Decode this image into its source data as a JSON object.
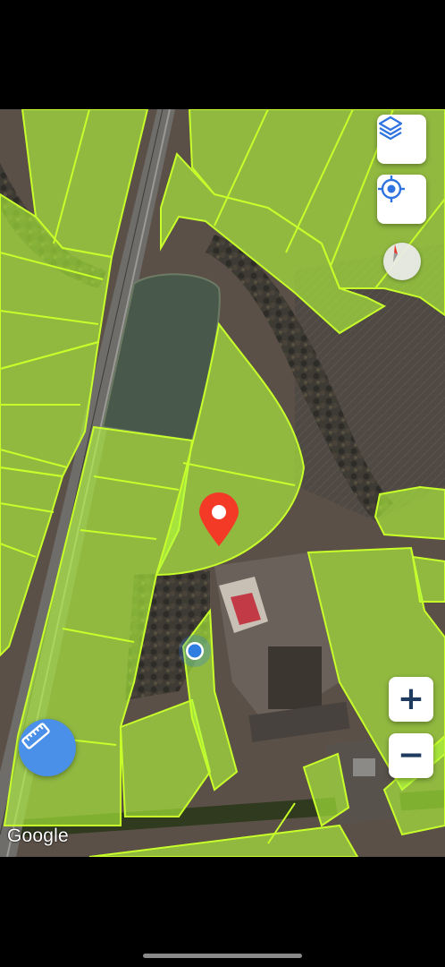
{
  "map": {
    "attribution": "Google",
    "controls": {
      "layers_icon": "layers-icon",
      "locate_icon": "crosshair-icon",
      "compass_icon": "compass-icon",
      "zoom_in_label": "+",
      "zoom_out_label": "−",
      "ruler_icon": "ruler-icon"
    },
    "markers": {
      "selected_pin": "location-pin-icon",
      "user_location": "blue-dot-icon"
    },
    "colors": {
      "parcel_fill": "#b6ff3c",
      "parcel_stroke": "#c8ff2a",
      "pin": "#f23a26",
      "user_dot": "#2f7de1",
      "accent_button": "#4a8fe8"
    }
  }
}
